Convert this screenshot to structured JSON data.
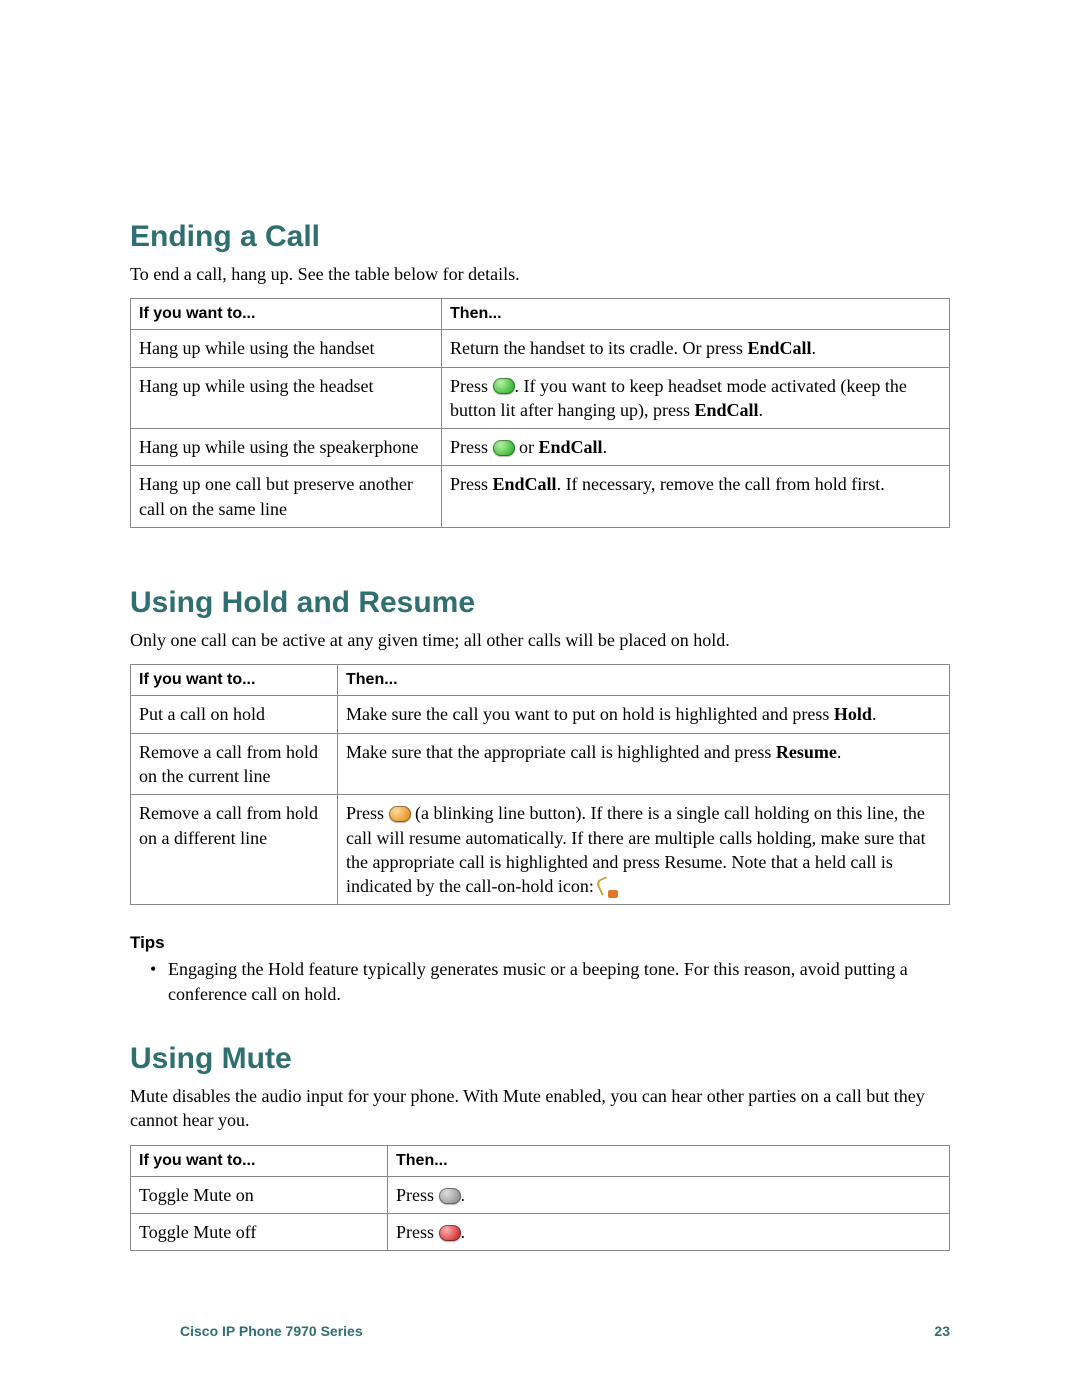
{
  "sections": {
    "ending": {
      "title": "Ending a Call",
      "intro": "To end a call, hang up. See the table below for details.",
      "headers": {
        "c1": "If you want to...",
        "c2": "Then..."
      },
      "rows": [
        {
          "c1": "Hang up while using the handset",
          "c2_pre": "Return the handset to its cradle. Or press ",
          "c2_bold": "EndCall",
          "c2_post": "."
        },
        {
          "c1": "Hang up while using the headset",
          "c2_pre": "Press ",
          "c2_mid": ". If you want to keep headset mode activated (keep the button lit after hanging up), press ",
          "c2_bold": "EndCall",
          "c2_post": "."
        },
        {
          "c1": "Hang up while using the speakerphone",
          "c2_pre": "Press ",
          "c2_mid": " or ",
          "c2_bold": "EndCall",
          "c2_post": "."
        },
        {
          "c1": "Hang up one call but preserve another call on the same line",
          "c2_pre": "Press ",
          "c2_bold": "EndCall",
          "c2_post": ". If necessary, remove the call from hold first."
        }
      ]
    },
    "hold": {
      "title": "Using Hold and Resume",
      "intro": "Only one call can be active at any given time; all other calls will be placed on hold.",
      "headers": {
        "c1": "If you want to...",
        "c2": "Then..."
      },
      "rows": [
        {
          "c1": "Put a call on hold",
          "c2_pre": "Make sure the call you want to put on hold is highlighted and press ",
          "c2_bold": "Hold",
          "c2_post": "."
        },
        {
          "c1": "Remove a call from hold on the current line",
          "c2_pre": "Make sure that the appropriate call is highlighted and press ",
          "c2_bold": "Resume",
          "c2_post": "."
        },
        {
          "c1": "Remove a call from hold on a different line",
          "c2_pre": "Press ",
          "c2_post": " (a blinking line button). If there is a single call holding on this line, the call will resume automatically. If there are multiple calls holding, make sure that the appropriate call is highlighted and press Resume. Note that a held call is indicated by the call-on-hold icon: "
        }
      ],
      "tips_label": "Tips",
      "tip": "Engaging the Hold feature typically generates music or a beeping tone. For this reason, avoid putting a conference call on hold."
    },
    "mute": {
      "title": "Using Mute",
      "intro": "Mute disables the audio input for your phone. With Mute enabled, you can hear other parties on a call but they cannot hear you.",
      "headers": {
        "c1": "If you want to...",
        "c2": "Then..."
      },
      "rows": [
        {
          "c1": "Toggle Mute on",
          "c2_pre": "Press ",
          "c2_post": "."
        },
        {
          "c1": "Toggle Mute off",
          "c2_pre": "Press ",
          "c2_post": "."
        }
      ]
    }
  },
  "footer": {
    "left": "Cisco IP Phone 7970 Series",
    "right": "23"
  }
}
